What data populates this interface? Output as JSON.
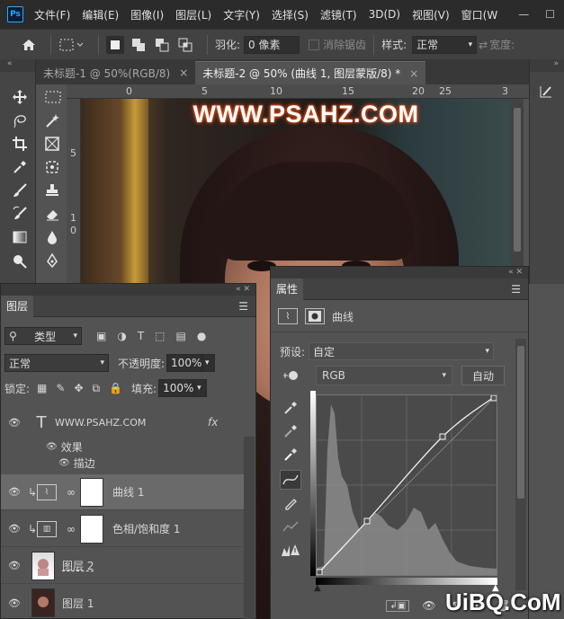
{
  "app": {
    "logo": "Ps"
  },
  "menu": [
    "文件(F)",
    "编辑(E)",
    "图像(I)",
    "图层(L)",
    "文字(Y)",
    "选择(S)",
    "滤镜(T)",
    "3D(D)",
    "视图(V)",
    "窗口(W"
  ],
  "window_buttons": [
    "—",
    "☐"
  ],
  "options": {
    "feather_label": "羽化:",
    "feather_value": "0 像素",
    "antialias_label": "消除锯齿",
    "style_label": "样式:",
    "style_value": "正常",
    "width_label": "宽度:"
  },
  "tabs": [
    {
      "label": "未标题-1 @ 50%(RGB/8)",
      "close": "×"
    },
    {
      "label": "未标题-2 @ 50% (曲线 1, 图层蒙版/8) *",
      "close": "×"
    }
  ],
  "ruler": {
    "top_ticks": [
      "0",
      "5",
      "10",
      "15",
      "20",
      "25",
      "3"
    ],
    "left_ticks": [
      "5",
      "1",
      "0"
    ]
  },
  "canvas": {
    "watermark": "WWW.PSAHZ.COM"
  },
  "layers_panel": {
    "tab": "图层",
    "filter_kind": "类型",
    "blend_mode": "正常",
    "opacity_label": "不透明度:",
    "opacity_value": "100%",
    "lock_label": "锁定:",
    "fill_label": "填充:",
    "fill_value": "100%",
    "layers": [
      {
        "name": "WWW.PSAHZ.COM",
        "kind": "text",
        "fx": "fx",
        "effects_label": "效果",
        "effect": "描边"
      },
      {
        "name": "曲线 1",
        "kind": "curves",
        "selected": true
      },
      {
        "name": "色相/饱和度 1",
        "kind": "hue"
      },
      {
        "name": "图层 2",
        "kind": "pixel"
      },
      {
        "name": "图层 1",
        "kind": "pixel"
      }
    ]
  },
  "properties_panel": {
    "tab": "属性",
    "title": "曲线",
    "preset_label": "预设:",
    "preset_value": "自定",
    "channel": "RGB",
    "auto_button": "自动",
    "curve_points": [
      [
        0,
        0
      ],
      [
        0.28,
        0.3
      ],
      [
        0.7,
        0.77
      ],
      [
        1,
        1
      ]
    ]
  },
  "site_watermark": "UiBQ.CoM"
}
